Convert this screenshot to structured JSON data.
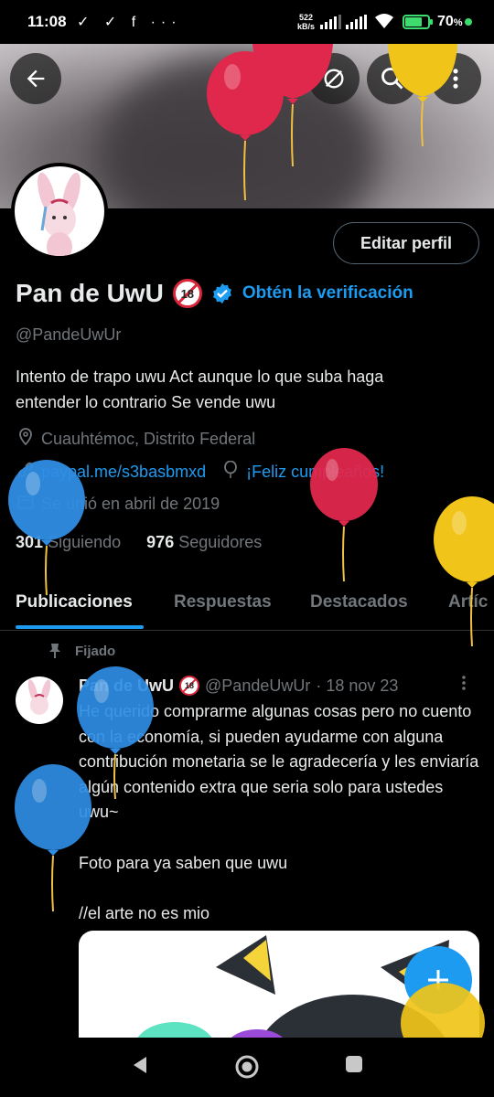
{
  "status_bar": {
    "time": "11:08",
    "left_icons": "✓ ✓ f ···",
    "speed_value": "522",
    "speed_unit": "kB/s",
    "battery": "70",
    "battery_suffix": "%"
  },
  "header": {
    "back_icon": "arrow-left-icon",
    "icons": [
      "eye-slash-icon",
      "search-icon",
      "more-vertical-icon"
    ]
  },
  "profile": {
    "name": "Pan de UwU",
    "age_badge": "18",
    "verify_cta": "Obtén la verificación",
    "handle": "@PandeUwUr",
    "edit_button": "Editar perfil",
    "bio_line1": "Intento de trapo uwu  Act aunque lo que suba haga",
    "bio_line2": "entender lo contrario  Se vende uwu",
    "location": "Cuauhtémoc, Distrito Federal",
    "website": "paypal.me/s3basbmxd",
    "birthday": "¡Feliz cumpleaños!",
    "joined": "Se unió en abril de 2019",
    "following_count": "301",
    "following_label": "Siguiendo",
    "followers_count": "976",
    "followers_label": "Seguidores"
  },
  "tabs": [
    {
      "label": "Publicaciones"
    },
    {
      "label": "Respuestas"
    },
    {
      "label": "Destacados"
    },
    {
      "label": "Artíc"
    }
  ],
  "pinned_label": "Fijado",
  "post": {
    "name": "Pan de UwU",
    "handle": "@PandeUwUr",
    "date": "· 18 nov 23",
    "text": "He querido comprarme algunas cosas pero no cuento con la economía, si pueden ayudarme con alguna contribución monetaria se le agradecería y les enviaría algún contenido extra que seria solo para ustedes uwu~\n\nFoto para ya saben que uwu\n\n//el arte no es mio"
  },
  "fab_icon": "plus-icon",
  "colors": {
    "accent": "#1d9bf0",
    "muted": "#71767b",
    "balloon_red": "#e0284d",
    "balloon_yellow": "#f0c419",
    "balloon_blue": "#2f8de4"
  }
}
